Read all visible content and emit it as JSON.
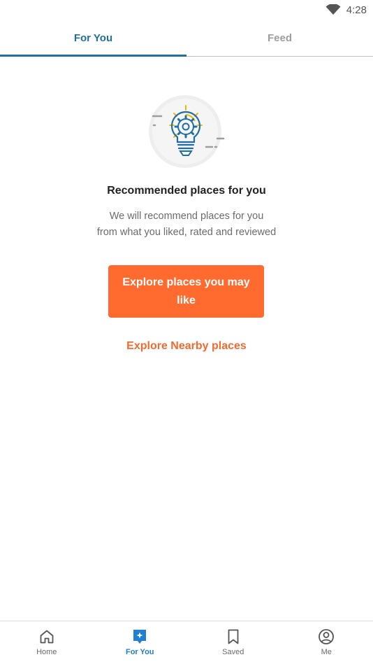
{
  "status_bar": {
    "time": "4:28"
  },
  "tabs": [
    {
      "label": "For You",
      "active": true
    },
    {
      "label": "Feed",
      "active": false
    }
  ],
  "hero": {
    "icon": "lightbulb-gear-icon"
  },
  "main": {
    "headline": "Recommended places for you",
    "subtext_line1": "We will recommend places for you",
    "subtext_line2": "from what you liked, rated and reviewed",
    "primary_button": "Explore places you may like",
    "secondary_link": "Explore Nearby places"
  },
  "bottom_nav": [
    {
      "label": "Home",
      "icon": "home-icon",
      "active": false
    },
    {
      "label": "For You",
      "icon": "for-you-icon",
      "active": true
    },
    {
      "label": "Saved",
      "icon": "bookmark-icon",
      "active": false
    },
    {
      "label": "Me",
      "icon": "profile-icon",
      "active": false
    }
  ],
  "colors": {
    "accent_blue": "#1f6fa3",
    "nav_active": "#1f7fd0",
    "orange": "#ff6a2f",
    "link_orange": "#f26b2c"
  }
}
